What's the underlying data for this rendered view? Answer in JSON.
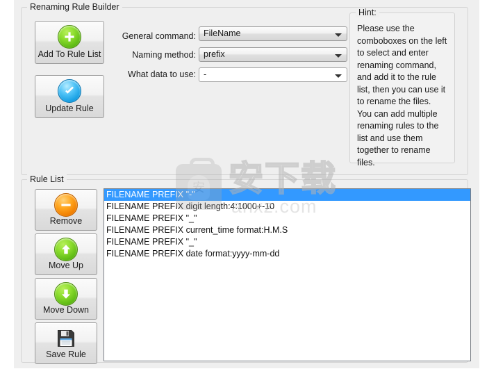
{
  "builder": {
    "title": "Renaming Rule Builder",
    "buttons": [
      {
        "label": "Add To Rule List",
        "icon": "plus-circle-icon"
      },
      {
        "label": "Update Rule",
        "icon": "check-circle-icon"
      }
    ],
    "fields": [
      {
        "label": "General command:",
        "value": "FileName",
        "editable": false
      },
      {
        "label": "Naming method:",
        "value": "prefix",
        "editable": false
      },
      {
        "label": "What data to use:",
        "value": "-",
        "editable": true
      }
    ]
  },
  "hint": {
    "title": "Hint:",
    "text": "Please use the comboboxes on the left to select and enter renaming command, and add it to the rule list, then you can use it to rename the files. You can add multiple renaming rules to the list and use them together to rename files."
  },
  "rule_list": {
    "title": "Rule List",
    "buttons": [
      {
        "label": "Remove",
        "icon": "minus-circle-icon"
      },
      {
        "label": "Move Up",
        "icon": "arrow-up-circle-icon"
      },
      {
        "label": "Move Down",
        "icon": "arrow-down-circle-icon"
      },
      {
        "label": "Save Rule",
        "icon": "floppy-disk-icon"
      }
    ],
    "rows": [
      {
        "text": "FILENAME PREFIX \"-\"",
        "selected": true
      },
      {
        "text": "FILENAME PREFIX digit length:4:1000+-10",
        "selected": false
      },
      {
        "text": "FILENAME PREFIX \"_\"",
        "selected": false
      },
      {
        "text": "FILENAME PREFIX current_time format:H.M.S",
        "selected": false
      },
      {
        "text": "FILENAME PREFIX \"_\"",
        "selected": false
      },
      {
        "text": "FILENAME PREFIX date format:yyyy-mm-dd",
        "selected": false
      }
    ]
  },
  "watermark": {
    "chinese": "安下载",
    "domain": "anxz.com"
  },
  "colors": {
    "selection": "#3399ff",
    "window": "#efefef",
    "border": "#d3d3d3"
  }
}
